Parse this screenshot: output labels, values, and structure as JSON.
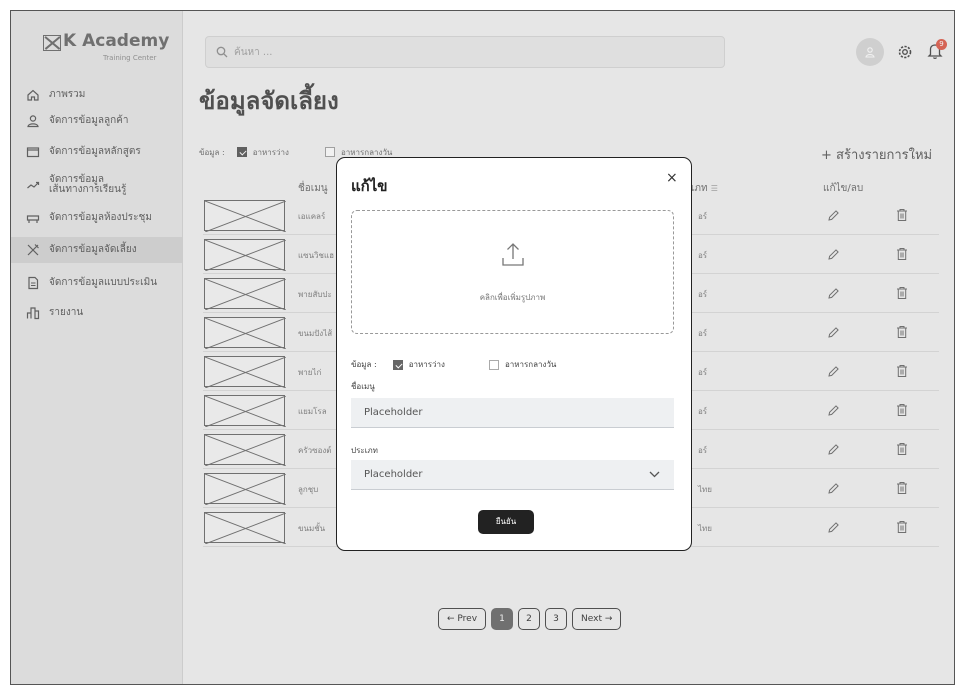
{
  "app": {
    "logo_title": "K Academy",
    "logo_subtitle": "Training Center"
  },
  "sidebar": {
    "items": [
      {
        "label": "ภาพรวม",
        "icon": "home-icon",
        "active": false
      },
      {
        "label": "จัดการข้อมูลลูกค้า",
        "icon": "user-icon",
        "active": false
      },
      {
        "label": "จัดการข้อมูลหลักสูตร",
        "icon": "folder-icon",
        "active": false
      },
      {
        "label": "จัดการข้อมูล\nเส้นทางการเรียนรู้",
        "icon": "trend-icon",
        "active": false
      },
      {
        "label": "จัดการข้อมูลห้องประชุม",
        "icon": "desk-icon",
        "active": false
      },
      {
        "label": "จัดการข้อมูลจัดเลี้ยง",
        "icon": "utensils-icon",
        "active": true
      },
      {
        "label": "จัดการข้อมูลแบบประเมิน",
        "icon": "document-icon",
        "active": false
      },
      {
        "label": "รายงาน",
        "icon": "report-icon",
        "active": false
      }
    ]
  },
  "header": {
    "search_placeholder": "ค้นหา ...",
    "notification_count": "9"
  },
  "page": {
    "title": "ข้อมูลจัดเลี้ยง",
    "filter_label": "ข้อมูล :",
    "filter_options": [
      {
        "label": "อาหารว่าง",
        "checked": true
      },
      {
        "label": "อาหารกลางวัน",
        "checked": false
      }
    ],
    "create_button": "+  สร้างรายการใหม่"
  },
  "table": {
    "headers": {
      "name": "ชื่อเมนู",
      "category": "เภท",
      "actions": "แก้ไข/ลบ"
    },
    "rows": [
      {
        "name": "เอแคลร์",
        "category": "อร์"
      },
      {
        "name": "แซนวิชแฮ",
        "category": "อร์"
      },
      {
        "name": "พายสับปะ",
        "category": "อร์"
      },
      {
        "name": "ขนมปังไส้",
        "category": "อร์"
      },
      {
        "name": "พายไก่",
        "category": "อร์"
      },
      {
        "name": "แยมโรล",
        "category": "อร์"
      },
      {
        "name": "ครัวซองต์",
        "category": "อร์"
      },
      {
        "name": "ลูกชุบ",
        "category": "ไทย"
      },
      {
        "name": "ขนมชั้น",
        "category": "ไทย"
      }
    ]
  },
  "pagination": {
    "prev": "← Prev",
    "pages": [
      "1",
      "2",
      "3"
    ],
    "current": "1",
    "next": "Next →"
  },
  "modal": {
    "title": "แก้ไข",
    "close": "×",
    "upload_label": "คลิกเพื่อเพิ่มรูปภาพ",
    "filter_label": "ข้อมูล :",
    "filter_options": [
      {
        "label": "อาหารว่าง",
        "checked": true
      },
      {
        "label": "อาหารกลางวัน",
        "checked": false
      }
    ],
    "menu_name_label": "ชื่อเมนู",
    "menu_name_value": "Placeholder",
    "category_label": "ประเภท",
    "category_value": "Placeholder",
    "confirm_button": "ยืนยัน"
  }
}
